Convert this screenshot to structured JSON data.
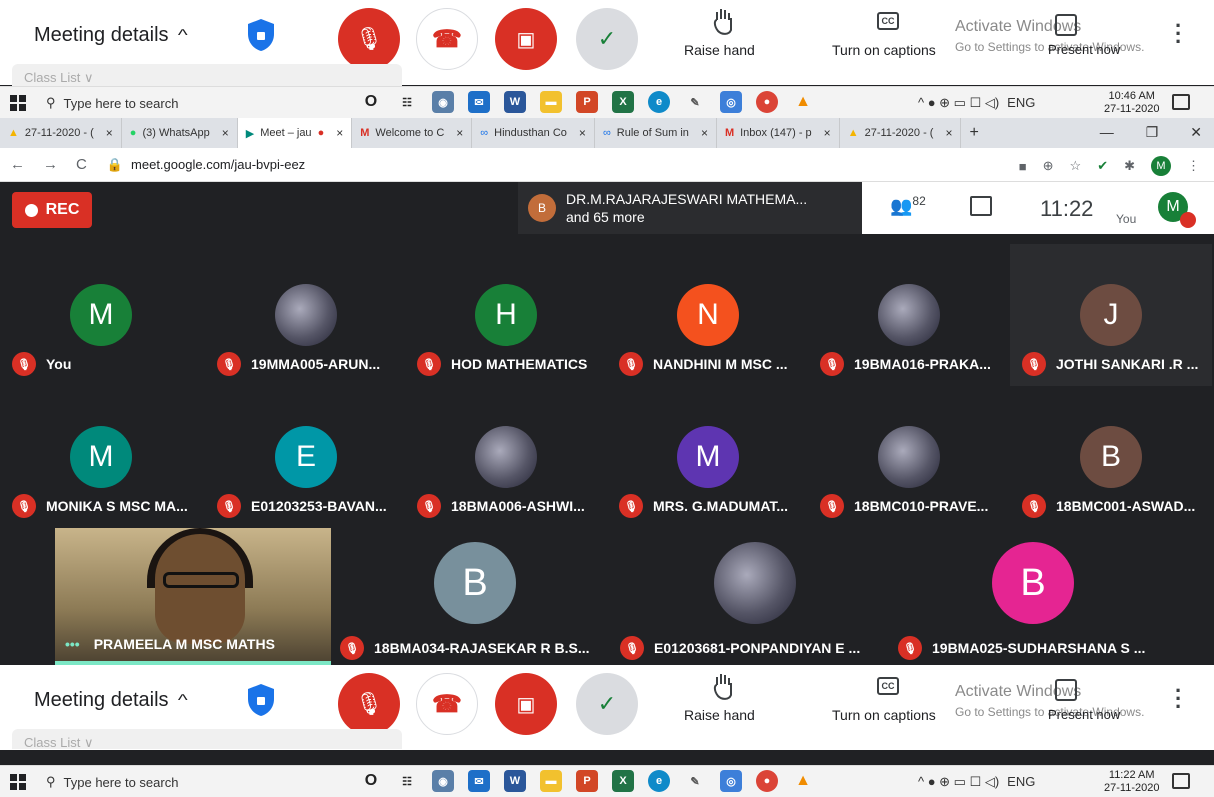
{
  "controls": {
    "meeting_details": "Meeting details",
    "raise_hand": "Raise hand",
    "captions": "Turn on captions",
    "activate": "Activate Windows",
    "activate_sub": "Go to Settings to activate Windows.",
    "present": "Present now",
    "class_list": "Class List ∨"
  },
  "taskbar": {
    "search_placeholder": "Type here to search",
    "lang": "ENG",
    "time_top": "10:46 AM",
    "date_top": "27-11-2020",
    "time_bottom": "11:22 AM",
    "date_bottom": "27-11-2020"
  },
  "tabs": [
    {
      "label": "27-11-2020 - ("
    },
    {
      "label": "(3) WhatsApp"
    },
    {
      "label": "Meet – jau"
    },
    {
      "label": "Welcome to C"
    },
    {
      "label": "Hindusthan Co"
    },
    {
      "label": "Rule of Sum in"
    },
    {
      "label": "Inbox (147) - p"
    },
    {
      "label": "27-11-2020 - ("
    }
  ],
  "address": {
    "url": "meet.google.com/jau-bvpi-eez"
  },
  "meet": {
    "rec": "REC",
    "speaker_initial": "B",
    "speaker_line1": "DR.M.RAJARAJESWARI MATHEMA...",
    "speaker_line2": "and 65 more",
    "people_count": "82",
    "time": "11:22",
    "you": "You",
    "you_initial": "M"
  },
  "participants": [
    {
      "name": "You",
      "initial": "M",
      "color": "#188038"
    },
    {
      "name": "19MMA005-ARUN...",
      "initial": "",
      "color": "photo"
    },
    {
      "name": "HOD MATHEMATICS",
      "initial": "H",
      "color": "#188038"
    },
    {
      "name": "NANDHINI M MSC ...",
      "initial": "N",
      "color": "#f4511e"
    },
    {
      "name": "19BMA016-PRAKA...",
      "initial": "",
      "color": "photo"
    },
    {
      "name": "JOTHI SANKARI .R ...",
      "initial": "J",
      "color": "#6d4c41"
    },
    {
      "name": "MONIKA S MSC MA...",
      "initial": "M",
      "color": "#00897b"
    },
    {
      "name": "E01203253-BAVAN...",
      "initial": "E",
      "color": "#0097a7"
    },
    {
      "name": "18BMA006-ASHWI...",
      "initial": "",
      "color": "photo"
    },
    {
      "name": "MRS. G.MADUMAT...",
      "initial": "M",
      "color": "#5e35b1"
    },
    {
      "name": "18BMC010-PRAVE...",
      "initial": "",
      "color": "photo"
    },
    {
      "name": "18BMC001-ASWAD...",
      "initial": "B",
      "color": "#6d4c41"
    }
  ],
  "row3": [
    {
      "name": "18BMA034-RAJASEKAR R B.S...",
      "initial": "B",
      "color": "#78909c"
    },
    {
      "name": "E01203681-PONPANDIYAN E ...",
      "initial": "",
      "color": "photo"
    },
    {
      "name": "19BMA025-SUDHARSHANA S ...",
      "initial": "B",
      "color": "#e52592"
    }
  ],
  "presenter": {
    "name": "PRAMEELA M MSC MATHS",
    "dots": "•••"
  }
}
